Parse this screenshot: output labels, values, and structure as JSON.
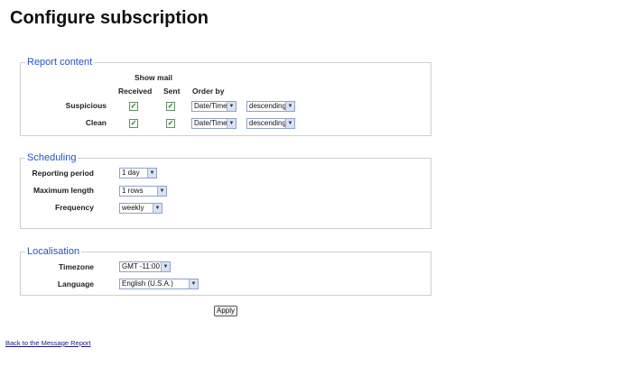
{
  "page": {
    "title": "Configure subscription"
  },
  "report_content": {
    "legend": "Report content",
    "show_mail_label": "Show mail",
    "columns": {
      "received": "Received",
      "sent": "Sent",
      "order_by": "Order by"
    },
    "rows": [
      {
        "label": "Suspicious",
        "received_checked": true,
        "sent_checked": true,
        "order_field": "Date/Time",
        "order_direction": "descending"
      },
      {
        "label": "Clean",
        "received_checked": true,
        "sent_checked": true,
        "order_field": "Date/Time",
        "order_direction": "descending"
      }
    ]
  },
  "scheduling": {
    "legend": "Scheduling",
    "reporting_period": {
      "label": "Reporting period",
      "value": "1 day"
    },
    "maximum_length": {
      "label": "Maximum length",
      "value": "1 rows"
    },
    "frequency": {
      "label": "Frequency",
      "value": "weekly"
    }
  },
  "localisation": {
    "legend": "Localisation",
    "timezone": {
      "label": "Timezone",
      "value": "GMT -11:00"
    },
    "language": {
      "label": "Language",
      "value": "English (U.S.A.)"
    }
  },
  "actions": {
    "apply_label": "Apply"
  },
  "footer": {
    "back_link": "Back to the Message Report"
  },
  "icons": {
    "checkbox_checked": "checkmark-icon",
    "dropdown": "chevron-down-icon"
  }
}
